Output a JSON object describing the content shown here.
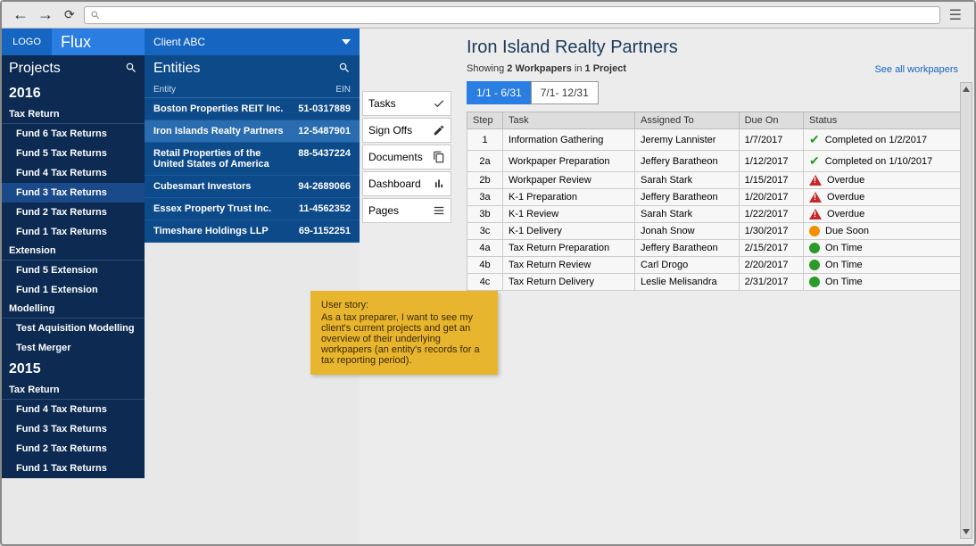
{
  "browser": {
    "url_hint": ""
  },
  "header": {
    "logo": "LOGO",
    "brand": "Flux",
    "client": "Client ABC"
  },
  "sidebar": {
    "title": "Projects",
    "years": [
      {
        "year": "2016",
        "groups": [
          {
            "label": "Tax Return",
            "items": [
              {
                "label": "Fund 6 Tax Returns",
                "active": false
              },
              {
                "label": "Fund 5 Tax Returns",
                "active": false
              },
              {
                "label": "Fund 4 Tax Returns",
                "active": false
              },
              {
                "label": "Fund 3 Tax Returns",
                "active": true
              },
              {
                "label": "Fund 2 Tax Returns",
                "active": false
              },
              {
                "label": "Fund 1 Tax Returns",
                "active": false
              }
            ]
          },
          {
            "label": "Extension",
            "items": [
              {
                "label": "Fund 5 Extension",
                "active": false
              },
              {
                "label": "Fund 1 Extension",
                "active": false
              }
            ]
          },
          {
            "label": "Modelling",
            "items": [
              {
                "label": "Test Aquisition Modelling",
                "active": false
              },
              {
                "label": "Test Merger",
                "active": false
              }
            ]
          }
        ]
      },
      {
        "year": "2015",
        "groups": [
          {
            "label": "Tax Return",
            "items": [
              {
                "label": "Fund 4 Tax Returns",
                "active": false
              },
              {
                "label": "Fund 3 Tax Returns",
                "active": false
              },
              {
                "label": "Fund 2 Tax Returns",
                "active": false
              },
              {
                "label": "Fund 1 Tax Returns",
                "active": false
              }
            ]
          }
        ]
      }
    ]
  },
  "entities": {
    "title": "Entities",
    "col_entity": "Entity",
    "col_ein": "EIN",
    "rows": [
      {
        "name": "Boston Properties REIT Inc.",
        "ein": "51-0317889",
        "active": false
      },
      {
        "name": "Iron Islands Realty Partners",
        "ein": "12-5487901",
        "active": true
      },
      {
        "name": "Retail Properties of the United States of America",
        "ein": "88-5437224",
        "active": false
      },
      {
        "name": "Cubesmart Investors",
        "ein": "94-2689066",
        "active": false
      },
      {
        "name": "Essex Property Trust Inc.",
        "ein": "11-4562352",
        "active": false
      },
      {
        "name": "Timeshare Holdings LLP",
        "ein": "69-1152251",
        "active": false
      }
    ]
  },
  "main": {
    "title": "Iron Island Realty Partners",
    "subtitle_prefix": "Showing ",
    "subtitle_wp_count": "2 Workpapers",
    "subtitle_in": " in ",
    "subtitle_proj_count": "1 Project",
    "see_all": "See all workpapers",
    "tabs": [
      {
        "label": "1/1 - 6/31",
        "active": true
      },
      {
        "label": "7/1- 12/31",
        "active": false
      }
    ],
    "menu": [
      {
        "label": "Tasks",
        "icon": "check"
      },
      {
        "label": "Sign Offs",
        "icon": "pencil"
      },
      {
        "label": "Documents",
        "icon": "copy"
      },
      {
        "label": "Dashboard",
        "icon": "chart"
      },
      {
        "label": "Pages",
        "icon": "list"
      }
    ],
    "table": {
      "headers": [
        "Step",
        "Task",
        "Assigned To",
        "Due On",
        "Status"
      ],
      "rows": [
        {
          "step": "1",
          "task": "Information Gathering",
          "assigned": "Jeremy Lannister",
          "due": "1/7/2017",
          "status_icon": "check",
          "status_text": "Completed on 1/2/2017"
        },
        {
          "step": "2a",
          "task": "Workpaper Preparation",
          "assigned": "Jeffery Baratheon",
          "due": "1/12/2017",
          "status_icon": "check",
          "status_text": "Completed on 1/10/2017"
        },
        {
          "step": "2b",
          "task": "Workpaper Review",
          "assigned": "Sarah Stark",
          "due": "1/15/2017",
          "status_icon": "warn",
          "status_text": "Overdue"
        },
        {
          "step": "3a",
          "task": "K-1 Preparation",
          "assigned": "Jeffery Baratheon",
          "due": "1/20/2017",
          "status_icon": "warn",
          "status_text": "Overdue"
        },
        {
          "step": "3b",
          "task": "K-1 Review",
          "assigned": "Sarah Stark",
          "due": "1/22/2017",
          "status_icon": "warn",
          "status_text": "Overdue"
        },
        {
          "step": "3c",
          "task": "K-1 Delivery",
          "assigned": "Jonah Snow",
          "due": "1/30/2017",
          "status_icon": "orange",
          "status_text": "Due Soon"
        },
        {
          "step": "4a",
          "task": "Tax Return Preparation",
          "assigned": "Jeffery Baratheon",
          "due": "2/15/2017",
          "status_icon": "green",
          "status_text": "On Time"
        },
        {
          "step": "4b",
          "task": "Tax Return Review",
          "assigned": "Carl Drogo",
          "due": "2/20/2017",
          "status_icon": "green",
          "status_text": "On Time"
        },
        {
          "step": "4c",
          "task": "Tax Return Delivery",
          "assigned": "Leslie Melisandra",
          "due": "2/31/2017",
          "status_icon": "green",
          "status_text": "On Time"
        }
      ]
    }
  },
  "sticky": {
    "title": "User story:",
    "body": "As a tax preparer, I want to see my client's current projects and get an overview of their underlying workpapers (an entity's records for a tax reporting period)."
  }
}
